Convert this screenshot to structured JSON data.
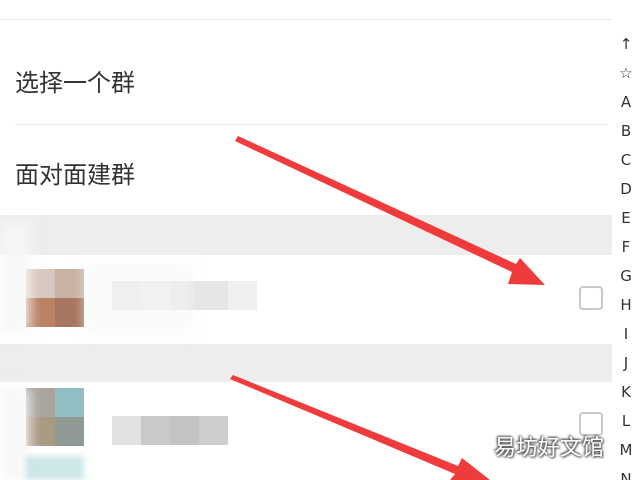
{
  "menu": {
    "select_group": "选择一个群",
    "face_to_face_group": "面对面建群"
  },
  "alpha_index": [
    "↑",
    "☆",
    "A",
    "B",
    "C",
    "D",
    "E",
    "F",
    "G",
    "H",
    "I",
    "J",
    "K",
    "L",
    "M",
    "N"
  ],
  "contacts": [
    {
      "checked": false,
      "name_blurred": true
    },
    {
      "checked": false,
      "name_blurred": true
    }
  ],
  "watermark": "易坊好文馆",
  "colors": {
    "annotation_arrow": "#ef3b3b",
    "section_header": "#ededed",
    "text": "#333333",
    "checkbox_border": "#c8c8c8"
  },
  "icons": {
    "index_top": "arrow-up-icon",
    "index_star": "star-icon",
    "checkbox": "checkbox-icon"
  }
}
